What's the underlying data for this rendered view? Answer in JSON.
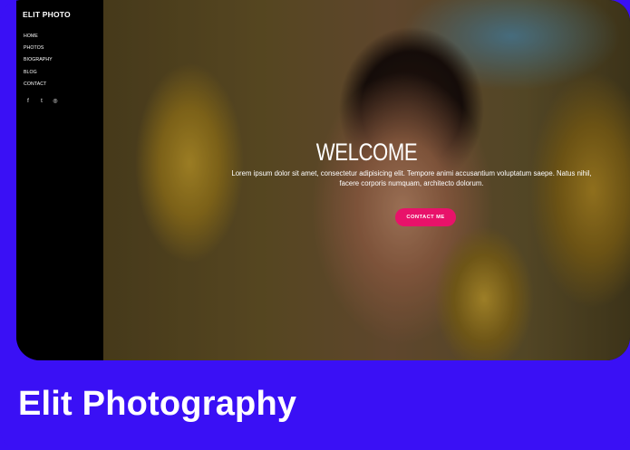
{
  "site": {
    "brand": "ELIT PHOTO",
    "nav": [
      "HOME",
      "PHOTOS",
      "BIOGRAPHY",
      "BLOG",
      "CONTACT"
    ],
    "social": [
      {
        "icon": "facebook-icon",
        "glyph": "f"
      },
      {
        "icon": "twitter-icon",
        "glyph": "t"
      },
      {
        "icon": "instagram-icon",
        "glyph": "◎"
      }
    ]
  },
  "hero": {
    "title": "WELCOME",
    "text": "Lorem ipsum dolor sit amet, consectetur adipisicing elit. Tempore animi accusantium voluptatum saepe. Natus nihil, facere corporis numquam, architecto dolorum.",
    "button_label": "CONTACT ME"
  },
  "caption": "Elit Photography",
  "colors": {
    "frame": "#3a10f5",
    "accent": "#e8126a",
    "sidebar": "#000000"
  }
}
